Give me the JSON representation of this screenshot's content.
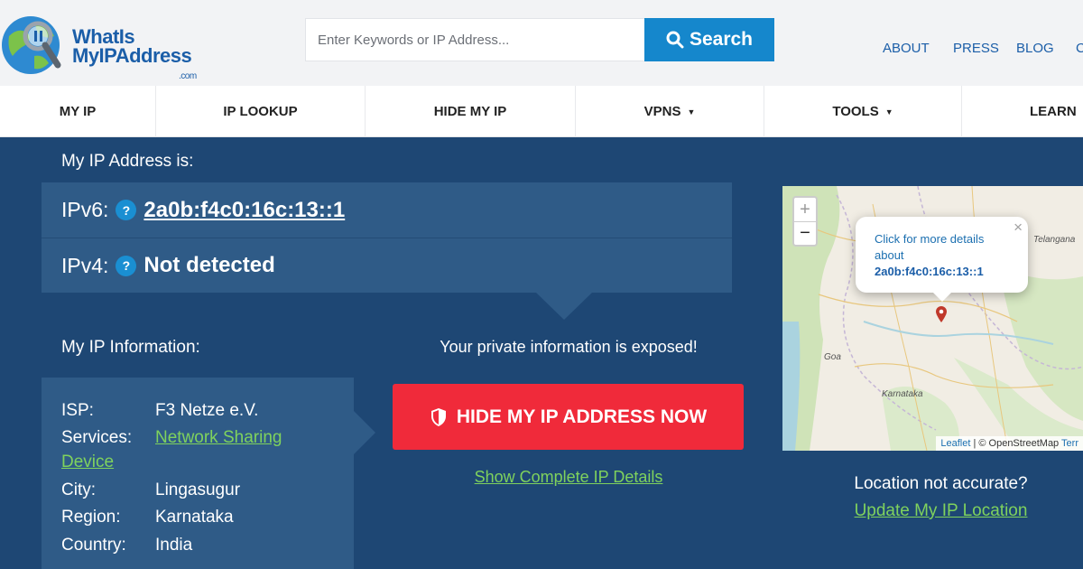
{
  "header": {
    "logo_line1": "WhatIs",
    "logo_line2": "MyIPAddress",
    "logo_suffix": ".com",
    "search_placeholder": "Enter Keywords or IP Address...",
    "search_label": "Search",
    "links": [
      "ABOUT",
      "PRESS",
      "BLOG",
      "C"
    ]
  },
  "nav": {
    "items": [
      {
        "label": "MY IP",
        "caret": ""
      },
      {
        "label": "IP LOOKUP",
        "caret": ""
      },
      {
        "label": "HIDE MY IP",
        "caret": ""
      },
      {
        "label": "VPNS",
        "caret": "▼"
      },
      {
        "label": "TOOLS",
        "caret": "▼"
      },
      {
        "label": "LEARN",
        "caret": "▼"
      }
    ]
  },
  "ip": {
    "heading": "My IP Address is:",
    "ipv6_label": "IPv6:",
    "ipv6_value": "2a0b:f4c0:16c:13::1",
    "ipv4_label": "IPv4:",
    "ipv4_value": "Not detected",
    "help": "?"
  },
  "info": {
    "heading": "My IP Information:",
    "rows": [
      {
        "key": "ISP:",
        "value": "F3 Netze e.V."
      },
      {
        "key": "Services:",
        "value": "Network Sharing",
        "value_cont": "Device"
      },
      {
        "key": "City:",
        "value": "Lingasugur"
      },
      {
        "key": "Region:",
        "value": "Karnataka"
      },
      {
        "key": "Country:",
        "value": "India"
      }
    ]
  },
  "cta": {
    "exposed": "Your private information is exposed!",
    "hide_button": "HIDE MY IP ADDRESS NOW",
    "show_details": "Show Complete IP Details"
  },
  "map": {
    "zoom_in": "+",
    "zoom_out": "−",
    "popup_line1": "Click for more details",
    "popup_line2": "about",
    "popup_ip": "2a0b:f4c0:16c:13::1",
    "popup_close": "×",
    "places": [
      "Telangana",
      "Goa",
      "Karnataka"
    ],
    "attrib_leaflet": "Leaflet",
    "attrib_sep": " | © OpenStreetMap ",
    "attrib_terms": "Terr",
    "colors": {
      "land": "#f1ede4",
      "green": "#cfe3b8",
      "water": "#aad3df",
      "marker": "#c0392b"
    }
  },
  "location": {
    "question": "Location not accurate?",
    "update_link": "Update My IP Location"
  },
  "colors": {
    "background": "#1e4774",
    "panel": "#2f5b87",
    "accent_blue": "#1587cc",
    "cta_red": "#f02a3a",
    "link_green": "#7fd25d"
  }
}
